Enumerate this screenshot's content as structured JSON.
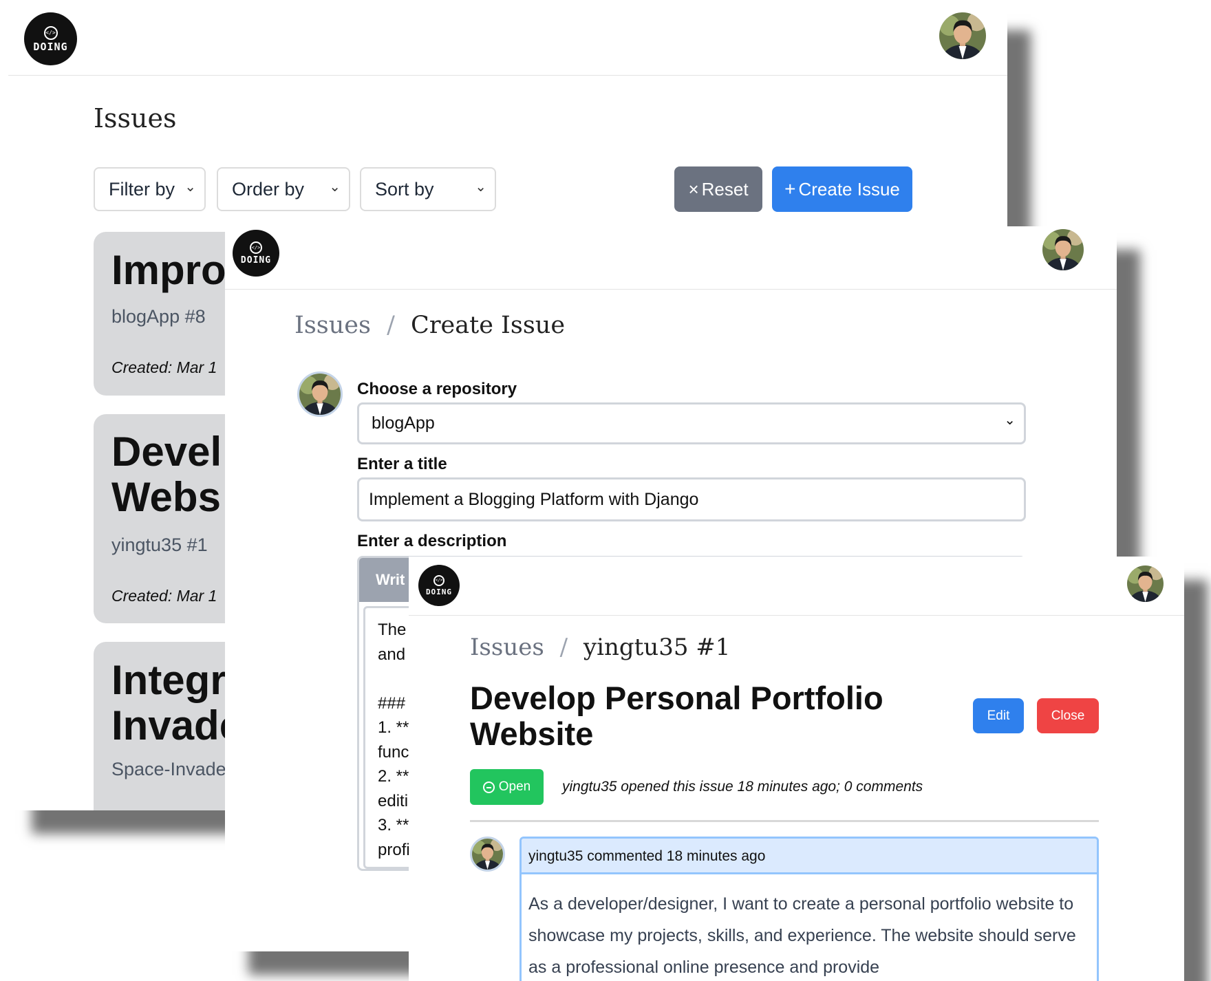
{
  "brand": {
    "logo_mark": "</>",
    "logo_text": "DOING"
  },
  "issues_page": {
    "title": "Issues",
    "filters": {
      "filter_by": "Filter by",
      "order_by": "Order by",
      "sort_by": "Sort by"
    },
    "reset_label": "Reset",
    "create_label": "Create Issue",
    "cards": [
      {
        "title_lines": [
          "Impro"
        ],
        "repo": "blogApp #8",
        "created": "Created: Mar 1"
      },
      {
        "title_lines": [
          "Devel",
          "Webs"
        ],
        "repo": "yingtu35 #1",
        "created": "Created: Mar 1"
      },
      {
        "title_lines": [
          "Integr",
          "Invade"
        ],
        "repo": "Space-Invade"
      }
    ]
  },
  "create_page": {
    "breadcrumb": {
      "parent": "Issues",
      "separator": "/",
      "current": "Create Issue"
    },
    "repo_label": "Choose a repository",
    "repo_value": "blogApp",
    "title_label": "Enter a title",
    "title_value": "Implement a Blogging Platform with Django",
    "description_label": "Enter a description",
    "description_tab": "Writ",
    "description_value": "The\nand\n\n###\n1. **\nfunc\n2. **\nediti\n3. **\nprofi"
  },
  "issue_page": {
    "breadcrumb": {
      "parent": "Issues",
      "separator": "/",
      "current": "yingtu35 #1"
    },
    "title": "Develop Personal Portfolio Website",
    "edit_label": "Edit",
    "close_label": "Close",
    "status": "Open",
    "meta": "yingtu35 opened this issue 18 minutes ago; 0 comments",
    "comment": {
      "header": "yingtu35 commented 18 minutes ago",
      "body": "As a developer/designer, I want to create a personal portfolio website to showcase my projects, skills, and experience. The website should serve as a professional online presence and provide"
    }
  },
  "colors": {
    "primary": "#2f80ed",
    "secondary": "#6b7280",
    "danger": "#ef4444",
    "success": "#22c55e",
    "card_bg": "#d8d9db",
    "comment_header_bg": "#dbeafe"
  }
}
